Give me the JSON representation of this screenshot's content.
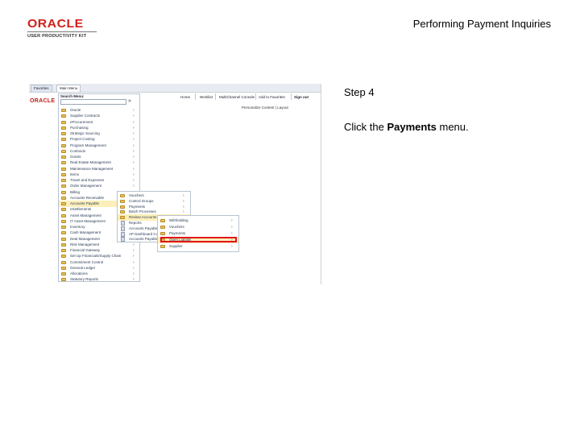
{
  "header": {
    "logo_word": "ORACLE",
    "logo_sub": "USER PRODUCTIVITY KIT",
    "title": "Performing Payment Inquiries"
  },
  "step": {
    "label": "Step 4",
    "instruction_prefix": "Click the ",
    "instruction_bold": "Payments",
    "instruction_suffix": " menu."
  },
  "screenshot": {
    "tabs": [
      "Favorites",
      "Main Menu"
    ],
    "top_links": [
      "Home",
      "Worklist",
      "MultiChannel Console",
      "Add to Favorites",
      "Sign out"
    ],
    "brand": "ORACLE",
    "personalize": "Personalize Content | Layout",
    "search_label": "Search Menu:",
    "search_go": "»",
    "nav_items": [
      {
        "label": "Oracle"
      },
      {
        "label": "Supplier Contracts"
      },
      {
        "label": "eProcurement"
      },
      {
        "label": "Purchasing"
      },
      {
        "label": "Strategic Sourcing"
      },
      {
        "label": "Project Costing"
      },
      {
        "label": "Program Management"
      },
      {
        "label": "Contracts"
      },
      {
        "label": "Grants"
      },
      {
        "label": "Real Estate Management"
      },
      {
        "label": "Maintenance Management"
      },
      {
        "label": "Items"
      },
      {
        "label": "Travel and Expenses"
      },
      {
        "label": "Order Management"
      },
      {
        "label": "Billing"
      },
      {
        "label": "Accounts Receivable"
      },
      {
        "label": "Accounts Payable"
      },
      {
        "label": "eSettlements"
      },
      {
        "label": "Asset Management"
      },
      {
        "label": "IT Asset Management"
      },
      {
        "label": "Inventory"
      },
      {
        "label": "Cash Management"
      },
      {
        "label": "Deal Management"
      },
      {
        "label": "Risk Management"
      },
      {
        "label": "Financial Gateway"
      },
      {
        "label": "Set Up Financials/Supply Chain"
      },
      {
        "label": "Commitment Control"
      },
      {
        "label": "General Ledger"
      },
      {
        "label": "Allocations"
      },
      {
        "label": "Statutory Reports"
      }
    ],
    "submenu_ap": [
      "Vouchers",
      "Control Groups",
      "Payments",
      "Batch Processes",
      "Review Accounts Payable Info",
      "Reports",
      "Accounts Payable WorkCenter",
      "AP Dashboard Collaboration",
      "Accounts Payable Dashboard"
    ],
    "submenu_review": [
      "Withholding",
      "Vouchers",
      "Payments",
      "Open Liability",
      "Supplier"
    ]
  }
}
